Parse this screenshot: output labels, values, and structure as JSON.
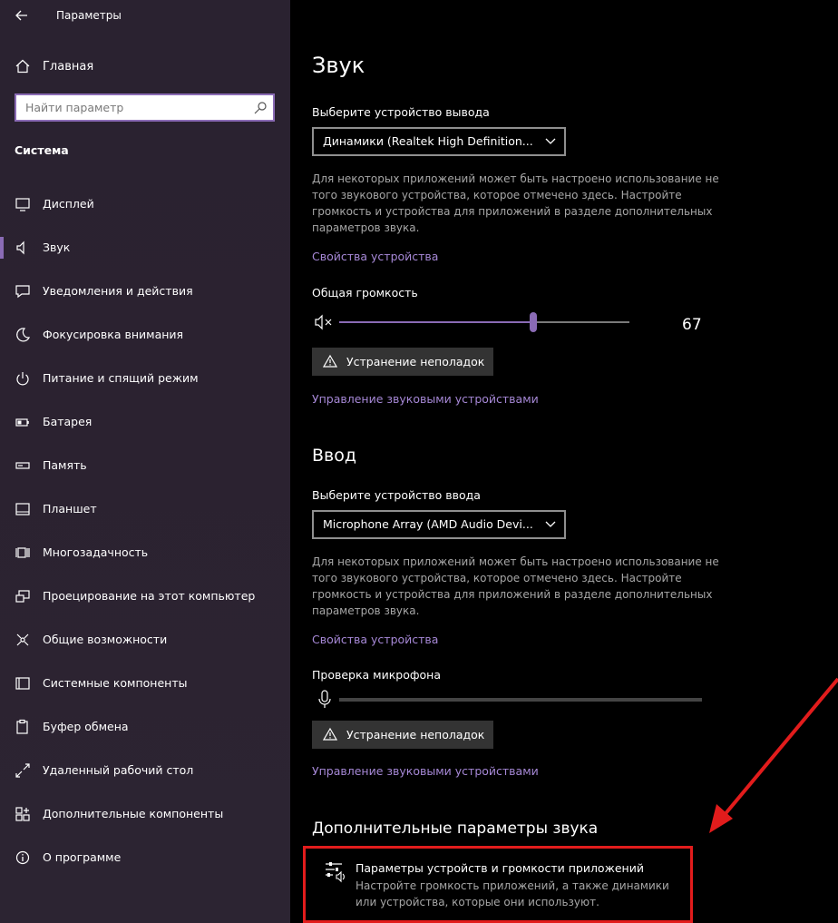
{
  "window": {
    "title": "Параметры"
  },
  "sidebar": {
    "home_label": "Главная",
    "search_placeholder": "Найти параметр",
    "section": "Система",
    "items": [
      {
        "label": "Дисплей",
        "icon": "display-icon"
      },
      {
        "label": "Звук",
        "icon": "speaker-icon",
        "active": true
      },
      {
        "label": "Уведомления и действия",
        "icon": "notification-icon"
      },
      {
        "label": "Фокусировка внимания",
        "icon": "moon-icon"
      },
      {
        "label": "Питание и спящий режим",
        "icon": "power-icon"
      },
      {
        "label": "Батарея",
        "icon": "battery-icon"
      },
      {
        "label": "Память",
        "icon": "storage-icon"
      },
      {
        "label": "Планшет",
        "icon": "tablet-icon"
      },
      {
        "label": "Многозадачность",
        "icon": "multitask-icon"
      },
      {
        "label": "Проецирование на этот компьютер",
        "icon": "project-icon"
      },
      {
        "label": "Общие возможности",
        "icon": "shared-icon"
      },
      {
        "label": "Системные компоненты",
        "icon": "components-icon"
      },
      {
        "label": "Буфер обмена",
        "icon": "clipboard-icon"
      },
      {
        "label": "Удаленный рабочий стол",
        "icon": "remote-desktop-icon"
      },
      {
        "label": "Дополнительные компоненты",
        "icon": "optional-features-icon"
      },
      {
        "label": "О программе",
        "icon": "info-icon"
      }
    ]
  },
  "main": {
    "title": "Звук",
    "output": {
      "label": "Выберите устройство вывода",
      "device": "Динамики (Realtek High Definition...",
      "desc": "Для некоторых приложений может быть настроено использование не того звукового устройства, которое отмечено здесь. Настройте громкость и устройства для приложений в разделе дополнительных параметров звука.",
      "properties_link": "Свойства устройства",
      "volume_label": "Общая громкость",
      "volume_value": "67",
      "volume_level": 0.67,
      "troubleshoot": "Устранение неполадок",
      "manage_link": "Управление звуковыми устройствами"
    },
    "input": {
      "title": "Ввод",
      "label": "Выберите устройство ввода",
      "device": "Microphone Array (AMD Audio Devi...",
      "desc": "Для некоторых приложений может быть настроено использование не того звукового устройства, которое отмечено здесь. Настройте громкость и устройства для приложений в разделе дополнительных параметров звука.",
      "properties_link": "Свойства устройства",
      "mic_test_label": "Проверка микрофона",
      "troubleshoot": "Устранение неполадок",
      "manage_link": "Управление звуковыми устройствами"
    },
    "advanced": {
      "title": "Дополнительные параметры звука",
      "card_title": "Параметры устройств и громкости приложений",
      "card_desc": "Настройте громкость приложений, а также динамики или устройства, которые они используют."
    }
  },
  "colors": {
    "accent": "#8a6bb5",
    "link": "#a688d6",
    "highlight": "#e21c1c"
  }
}
